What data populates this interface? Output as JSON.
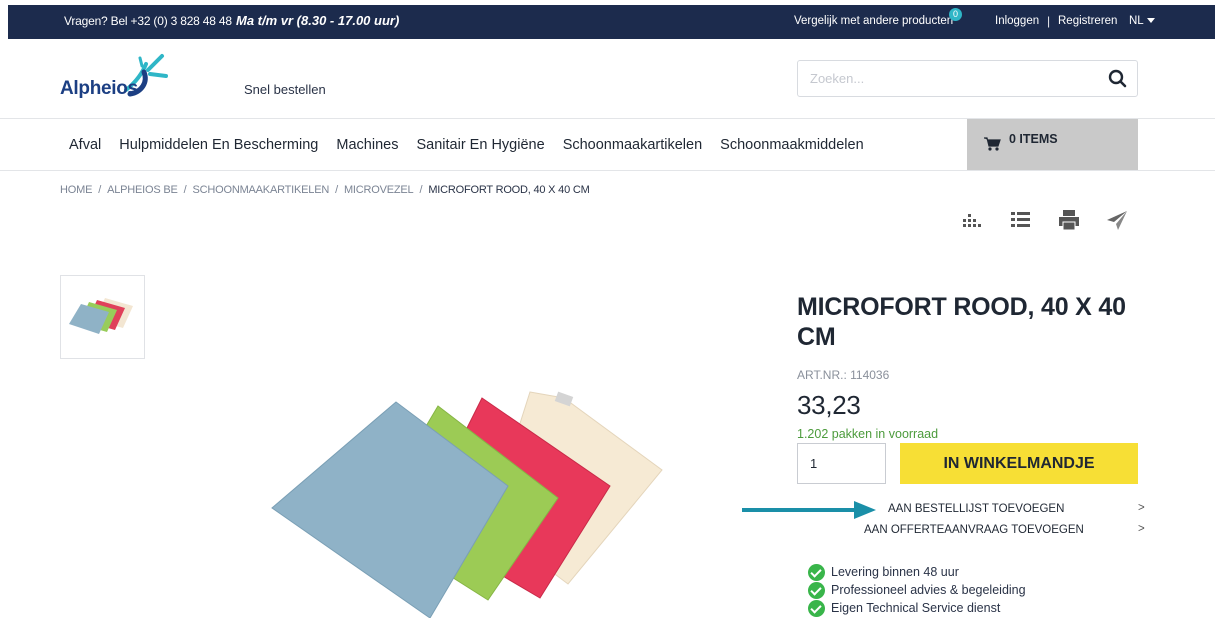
{
  "topbar": {
    "phone": "Vragen? Bel +32 (0) 3 828 48 48",
    "hours": "Ma t/m vr (8.30 - 17.00 uur)",
    "compare": "Vergelijk met andere producten",
    "compare_count": "0",
    "login": "Inloggen",
    "separator": "|",
    "register": "Registreren",
    "language": "NL"
  },
  "header": {
    "logo_text": "Alpheios",
    "quick_order": "Snel bestellen",
    "search_placeholder": "Zoeken..."
  },
  "nav": {
    "items": [
      "Afval",
      "Hulpmiddelen En Bescherming",
      "Machines",
      "Sanitair En Hygiëne",
      "Schoonmaakartikelen",
      "Schoonmaakmiddelen"
    ]
  },
  "cart": {
    "label": "0 ITEMS"
  },
  "breadcrumb": [
    "HOME",
    "ALPHEIOS BE",
    "SCHOONMAAKARTIKELEN",
    "MICROVEZEL",
    "MICROFORT ROOD, 40 X 40 CM"
  ],
  "tools": [
    "compare-icon",
    "list-icon",
    "print-icon",
    "share-icon"
  ],
  "product": {
    "title": "MICROFORT ROOD, 40 X 40 CM",
    "artnr": "ART.NR.: 114036",
    "price": "33,23",
    "stock": "1.202 pakken in voorraad",
    "quantity": "1",
    "add_to_cart": "IN WINKELMANDJE",
    "add_to_order_list": "AAN BESTELLIJST TOEVOEGEN",
    "add_to_quote": "AAN OFFERTEAANVRAAG TOEVOEGEN",
    "chevron": ">"
  },
  "usps": [
    "Levering binnen 48 uur",
    "Professioneel advies & begeleiding",
    "Eigen Technical Service dienst"
  ],
  "colors": {
    "topbar": "#1c2b4d",
    "accent_yellow": "#f7df35",
    "brand_blue": "#1c3f83",
    "brand_teal": "#2fb6c7",
    "stock_green": "#4c9b3c",
    "arrow_teal": "#1a8fa8"
  }
}
